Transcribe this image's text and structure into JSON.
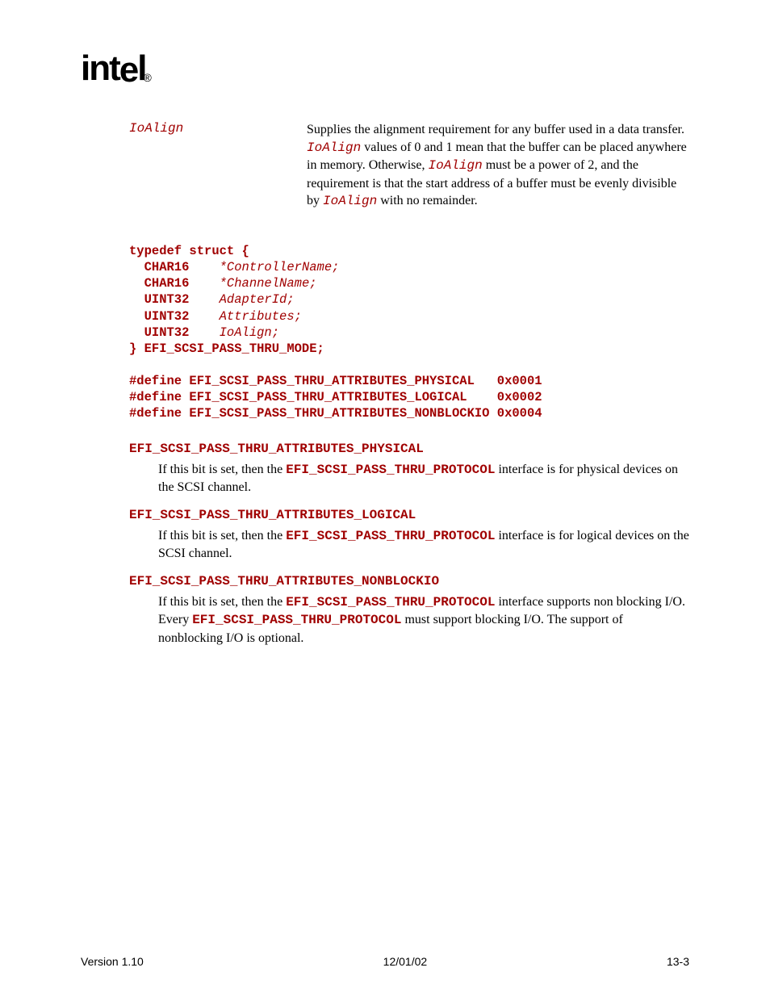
{
  "logo": "intel",
  "param": {
    "term": "IoAlign",
    "desc_before": "Supplies the alignment requirement for any buffer used in a data transfer.  ",
    "v1": "IoAlign",
    "desc_mid1": " values of 0 and 1 mean that the buffer can be placed anywhere in memory.  Otherwise, ",
    "v2": "IoAlign",
    "desc_mid2": " must be a power of 2, and the requirement is that the start address of a buffer must be evenly divisible by ",
    "v3": "IoAlign",
    "desc_after": " with no remainder."
  },
  "code": {
    "l1a": "typedef struct {",
    "l2a": "  CHAR16    ",
    "l2b": "*ControllerName;",
    "l3a": "  CHAR16    ",
    "l3b": "*ChannelName;",
    "l4a": "  UINT32    ",
    "l4b": "AdapterId;",
    "l5a": "  UINT32    ",
    "l5b": "Attributes;",
    "l6a": "  UINT32    ",
    "l6b": "IoAlign;",
    "l7a": "} EFI_SCSI_PASS_THRU_MODE;",
    "d1": "#define EFI_SCSI_PASS_THRU_ATTRIBUTES_PHYSICAL   0x0001",
    "d2": "#define EFI_SCSI_PASS_THRU_ATTRIBUTES_LOGICAL    0x0002",
    "d3": "#define EFI_SCSI_PASS_THRU_ATTRIBUTES_NONBLOCKIO 0x0004"
  },
  "attrs": {
    "a1name": "EFI_SCSI_PASS_THRU_ATTRIBUTES_PHYSICAL",
    "a1p1": "If this bit is set, then the ",
    "a1code": "EFI_SCSI_PASS_THRU_PROTOCOL",
    "a1p2": " interface is for physical devices on the SCSI channel.",
    "a2name": "EFI_SCSI_PASS_THRU_ATTRIBUTES_LOGICAL",
    "a2p1": "If this bit is set, then the ",
    "a2code": "EFI_SCSI_PASS_THRU_PROTOCOL",
    "a2p2": " interface is for logical devices on the SCSI channel.",
    "a3name": "EFI_SCSI_PASS_THRU_ATTRIBUTES_NONBLOCKIO",
    "a3p1": "If this bit is set, then the ",
    "a3code1": "EFI_SCSI_PASS_THRU_PROTOCOL",
    "a3p2": " interface supports non blocking I/O.  Every ",
    "a3code2": "EFI_SCSI_PASS_THRU_PROTOCOL",
    "a3p3": " must support blocking I/O.  The support of nonblocking I/O is optional."
  },
  "footer": {
    "left": "Version 1.10",
    "center": "12/01/02",
    "right": "13-3"
  }
}
